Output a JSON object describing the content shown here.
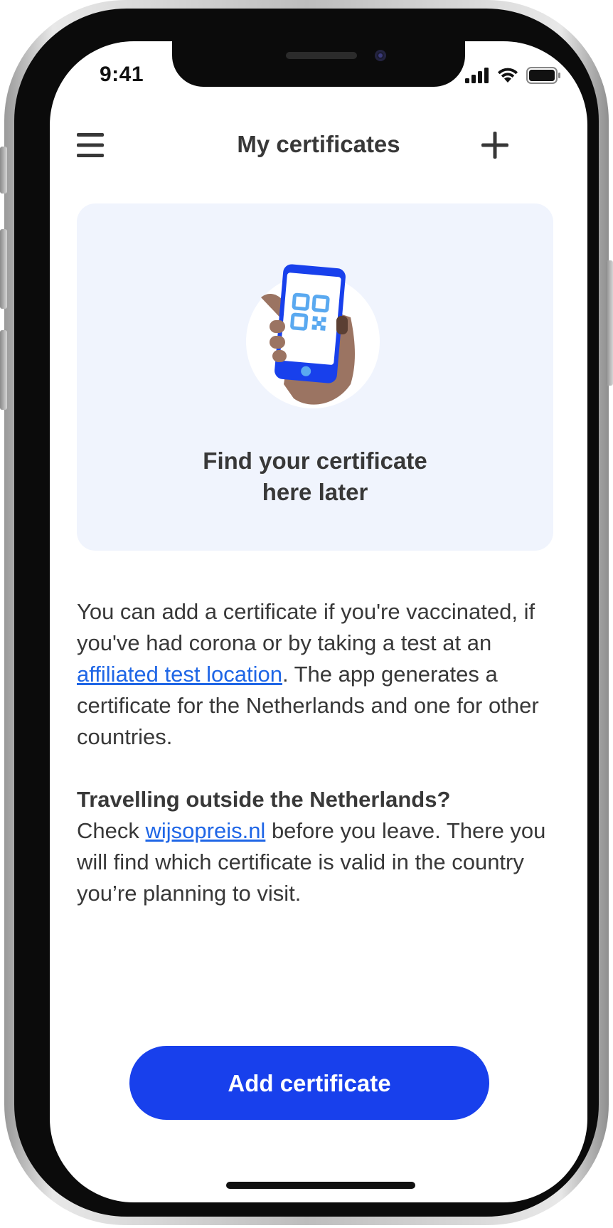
{
  "status_bar": {
    "time": "9:41"
  },
  "nav": {
    "title": "My certificates"
  },
  "card": {
    "title": "Find your certificate\nhere later"
  },
  "body": {
    "p1_before_link": "You can add a certificate if you're vaccinated, if you've had corona or by taking a test at an ",
    "p1_link": "affiliated test location",
    "p1_after_link": ". The app generates a certificate for the Netherlands and one for other countries.",
    "p2_heading": "Travelling outside the Netherlands?",
    "p2_before_link": "Check ",
    "p2_link": "wijsopreis.nl",
    "p2_after_link": " before you leave. There you will find which certificate is valid in the country you’re planning to visit."
  },
  "primary_button": {
    "label": "Add certificate"
  },
  "colors": {
    "accent": "#1840ec",
    "link": "#1f66e6",
    "card_background": "#f0f4fd",
    "text": "#383838"
  },
  "icons": {
    "menu": "menu-icon",
    "add": "plus-icon",
    "illustration": "phone-qr-hand-illustration"
  }
}
